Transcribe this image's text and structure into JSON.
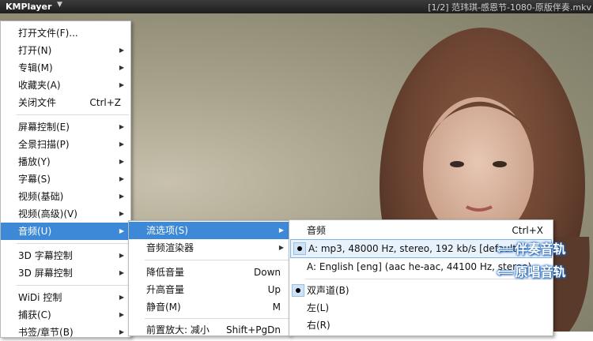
{
  "app": {
    "name": "KMPlayer",
    "video_title": "[1/2] 范玮琪-感恩节-1080-原版伴奏.mkv"
  },
  "main_menu": [
    {
      "label": "打开文件(F)...",
      "shortcut": "",
      "arrow": false
    },
    {
      "label": "打开(N)",
      "shortcut": "",
      "arrow": true
    },
    {
      "label": "专辑(M)",
      "shortcut": "",
      "arrow": true
    },
    {
      "label": "收藏夹(A)",
      "shortcut": "",
      "arrow": true
    },
    {
      "label": "关闭文件",
      "shortcut": "Ctrl+Z",
      "arrow": false
    },
    {
      "label": "屏幕控制(E)",
      "shortcut": "",
      "arrow": true
    },
    {
      "label": "全景扫描(P)",
      "shortcut": "",
      "arrow": true
    },
    {
      "label": "播放(Y)",
      "shortcut": "",
      "arrow": true
    },
    {
      "label": "字幕(S)",
      "shortcut": "",
      "arrow": true
    },
    {
      "label": "视频(基础)",
      "shortcut": "",
      "arrow": true
    },
    {
      "label": "视频(高级)(V)",
      "shortcut": "",
      "arrow": true
    },
    {
      "label": "音频(U)",
      "shortcut": "",
      "arrow": true
    },
    {
      "label": "3D 字幕控制",
      "shortcut": "",
      "arrow": true
    },
    {
      "label": "3D 屏幕控制",
      "shortcut": "",
      "arrow": true
    },
    {
      "label": "WiDi 控制",
      "shortcut": "",
      "arrow": true
    },
    {
      "label": "捕获(C)",
      "shortcut": "",
      "arrow": true
    },
    {
      "label": "书签/章节(B)",
      "shortcut": "",
      "arrow": true
    }
  ],
  "audio_menu": [
    {
      "label": "流选项(S)",
      "shortcut": "",
      "arrow": true
    },
    {
      "label": "音频渲染器",
      "shortcut": "",
      "arrow": true
    },
    {
      "label": "降低音量",
      "shortcut": "Down",
      "arrow": false
    },
    {
      "label": "升高音量",
      "shortcut": "Up",
      "arrow": false
    },
    {
      "label": "静音(M)",
      "shortcut": "M",
      "arrow": false
    },
    {
      "label": "前置放大: 减小",
      "shortcut": "Shift+PgDn",
      "arrow": false
    }
  ],
  "stream_menu": [
    {
      "label": "音频",
      "shortcut": "Ctrl+X",
      "checked": false
    },
    {
      "label": "A: mp3, 48000 Hz, stereo, 192 kb/s [default]",
      "shortcut": "",
      "checked": true
    },
    {
      "label": "A: English [eng] (aac he-aac, 44100 Hz, stereo)",
      "shortcut": "",
      "checked": false
    },
    {
      "label": "双声道(B)",
      "shortcut": "",
      "checked": true
    },
    {
      "label": "左(L)",
      "shortcut": "",
      "checked": false
    },
    {
      "label": "右(R)",
      "shortcut": "",
      "checked": false
    }
  ],
  "annotations": {
    "accompaniment": "伴奏音轨",
    "original": "原唱音轨",
    "arrow": "⟸"
  },
  "colors": {
    "highlight": "#3d89d8",
    "annotation_glow": "#1a62b8"
  }
}
